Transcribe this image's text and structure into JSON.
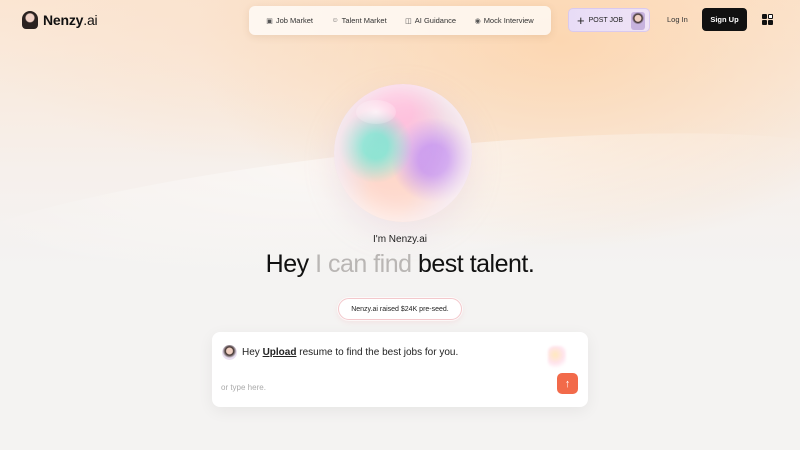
{
  "header": {
    "brand": "Nenzy",
    "brand_suffix": ".ai",
    "nav": [
      {
        "label": "Job Market",
        "icon": "briefcase-icon"
      },
      {
        "label": "Talent Market",
        "icon": "user-icon"
      },
      {
        "label": "AI Guidance",
        "icon": "book-icon"
      },
      {
        "label": "Mock Interview",
        "icon": "target-icon"
      }
    ],
    "post_job": "POST JOB",
    "login": "Log In",
    "signup": "Sign Up"
  },
  "hero": {
    "intro": "I'm Nenzy.ai",
    "headline_start": "Hey",
    "headline_muted": "I can find",
    "headline_end": "best talent.",
    "badge": "Nenzy.ai raised $24K pre-seed."
  },
  "chat": {
    "msg_prefix": "Hey",
    "msg_link": "Upload",
    "msg_suffix": "resume to find the best jobs for you.",
    "placeholder": "or type here.",
    "send_icon": "arrow-up-icon"
  },
  "colors": {
    "accent": "#f26a4a",
    "dark": "#111111",
    "post_job_bg": "#e8dcf6"
  }
}
